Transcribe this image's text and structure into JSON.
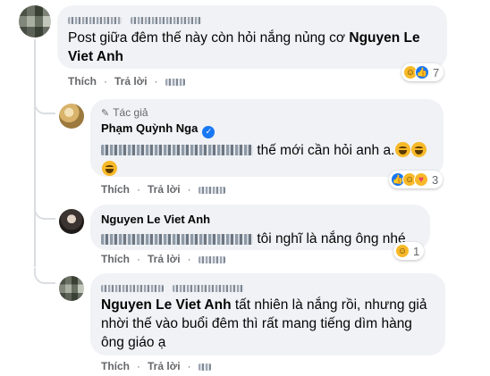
{
  "comments": [
    {
      "author": "",
      "text_plain": "Post giữa đêm thế này còn hỏi nắng nủng cơ",
      "text_mention": "Nguyen Le Viet Anh",
      "reactions_count": "7"
    },
    {
      "author_tag": "Tác giả",
      "author": "Phạm Quỳnh Nga",
      "text_plain": "thế mới cần hỏi anh a.",
      "reactions_count": "3"
    },
    {
      "author": "Nguyen Le Viet Anh",
      "text_plain": "tôi nghĩ là nắng ông nhé",
      "reactions_count": "1"
    },
    {
      "author": "",
      "text_mention": "Nguyen Le Viet Anh",
      "text_plain": "tất nhiên là nắng rồi, nhưng giả nhời thế vào buổi đêm thì rất mang tiếng dìm hàng ông giáo ạ"
    }
  ],
  "actions": {
    "like": "Thích",
    "reply": "Trả lời",
    "separator": "·"
  },
  "icons": {
    "verified": "verified-badge-icon",
    "pen": "pen-icon",
    "haha": "haha-reaction-icon",
    "like": "like-reaction-icon",
    "care": "care-reaction-icon"
  },
  "colors": {
    "bubble": "#f0f2f5",
    "link_blue": "#1877f2",
    "meta_gray": "#65676b"
  }
}
